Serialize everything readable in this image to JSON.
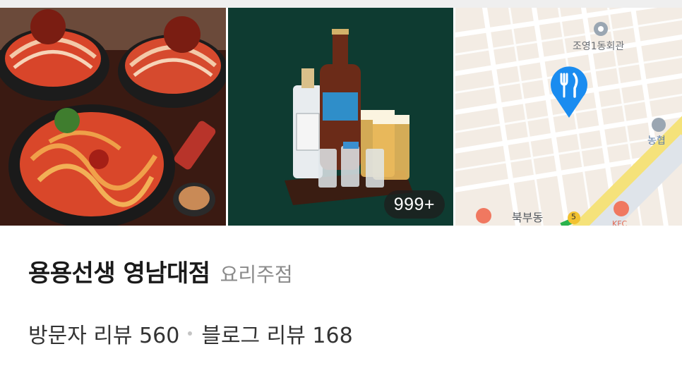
{
  "place": {
    "name": "용용선생 영남대점",
    "category": "요리주점"
  },
  "photos": {
    "food_alt": "food-photo",
    "drinks_count_badge": "999+"
  },
  "map": {
    "labels": {
      "community_center": "조영1동회관",
      "bank": "농협",
      "district": "북부동",
      "route": "5",
      "kfc": "KFC"
    },
    "marker_icon": "fork-knife-icon"
  },
  "reviews": {
    "visitor_label": "방문자 리뷰 560",
    "blog_label": "블로그 리뷰 168"
  },
  "colors": {
    "marker": "#1a8cf0",
    "road_yellow": "#f5e27a",
    "map_bg": "#f3ece4"
  }
}
